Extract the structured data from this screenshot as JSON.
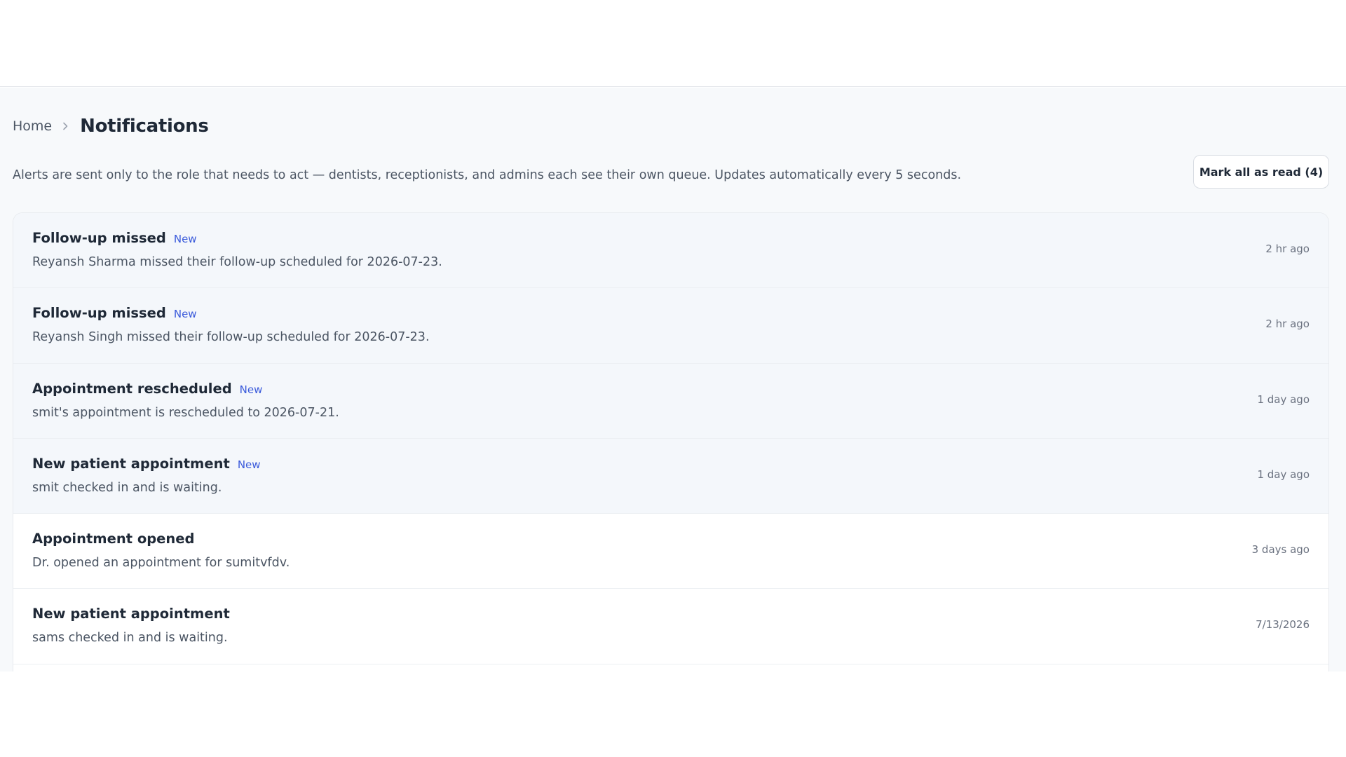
{
  "breadcrumb": {
    "home": "Home",
    "current": "Notifications"
  },
  "description": "Alerts are sent only to the role that needs to act — dentists, receptionists, and admins each see their own queue. Updates automatically every 5 seconds.",
  "mark_all_button": "Mark all as read (4)",
  "new_badge": "New",
  "colors": {
    "accent": "#3b5bdb",
    "unread_row_bg": "#f4f7fb"
  },
  "notifications": [
    {
      "title": "Follow-up missed",
      "message": "Reyansh Sharma missed their follow-up scheduled for 2026-07-23.",
      "time": "2 hr ago",
      "is_new": true
    },
    {
      "title": "Follow-up missed",
      "message": "Reyansh Singh missed their follow-up scheduled for 2026-07-23.",
      "time": "2 hr ago",
      "is_new": true
    },
    {
      "title": "Appointment rescheduled",
      "message": "smit's appointment is rescheduled to 2026-07-21.",
      "time": "1 day ago",
      "is_new": true
    },
    {
      "title": "New patient appointment",
      "message": "smit checked in and is waiting.",
      "time": "1 day ago",
      "is_new": true
    },
    {
      "title": "Appointment opened",
      "message": "Dr. opened an appointment for sumitvfdv.",
      "time": "3 days ago",
      "is_new": false
    },
    {
      "title": "New patient appointment",
      "message": "sams checked in and is waiting.",
      "time": "7/13/2026",
      "is_new": false
    }
  ]
}
